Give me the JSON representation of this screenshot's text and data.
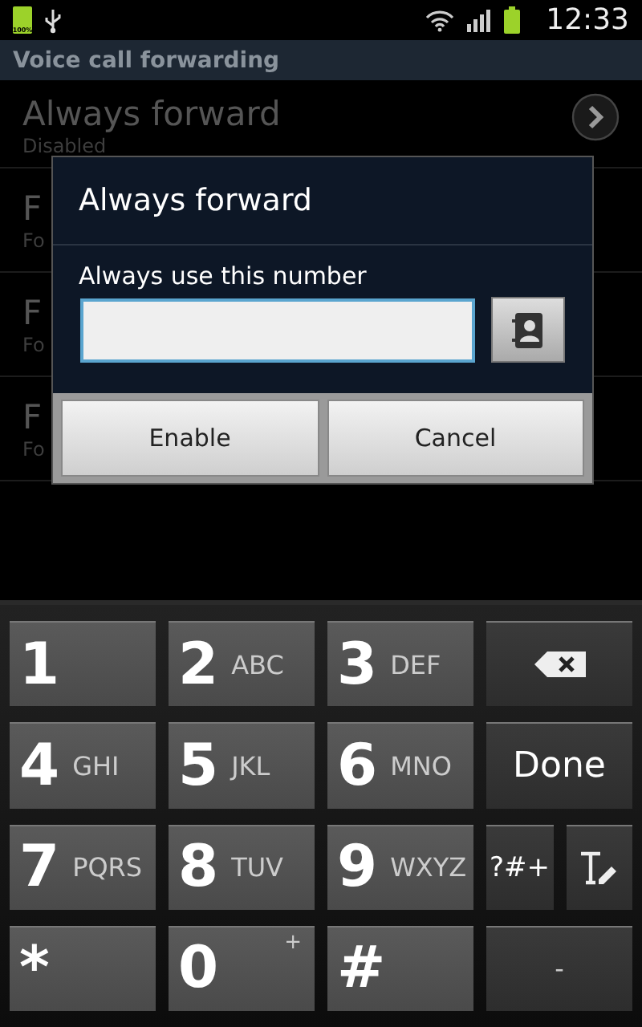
{
  "status_bar": {
    "battery_label": "100%",
    "time": "12:33"
  },
  "title": "Voice call forwarding",
  "list": [
    {
      "title": "Always forward",
      "subtitle": "Disabled"
    },
    {
      "title": "F",
      "subtitle": "Fo"
    },
    {
      "title": "F",
      "subtitle": "Fo"
    },
    {
      "title": "F",
      "subtitle": "Fo"
    }
  ],
  "dialog": {
    "title": "Always forward",
    "label": "Always use this number",
    "buttons": [
      "Enable",
      "Cancel"
    ]
  },
  "keypad": [
    {
      "kind": "digit",
      "main": "1"
    },
    {
      "kind": "digit",
      "main": "2",
      "sub": "ABC"
    },
    {
      "kind": "digit",
      "main": "3",
      "sub": "DEF"
    },
    {
      "kind": "backspace"
    },
    {
      "kind": "digit",
      "main": "4",
      "sub": "GHI"
    },
    {
      "kind": "digit",
      "main": "5",
      "sub": "JKL"
    },
    {
      "kind": "digit",
      "main": "6",
      "sub": "MNO"
    },
    {
      "kind": "text",
      "main": "Done"
    },
    {
      "kind": "digit",
      "main": "7",
      "sub": "PQRS"
    },
    {
      "kind": "digit",
      "main": "8",
      "sub": "TUV"
    },
    {
      "kind": "digit",
      "main": "9",
      "sub": "WXYZ"
    },
    {
      "kind": "split",
      "main": "?#+"
    },
    {
      "kind": "digit",
      "main": "*"
    },
    {
      "kind": "zero",
      "main": "0",
      "sup": "+"
    },
    {
      "kind": "digit",
      "main": "#"
    },
    {
      "kind": "dash",
      "main": "-"
    }
  ]
}
